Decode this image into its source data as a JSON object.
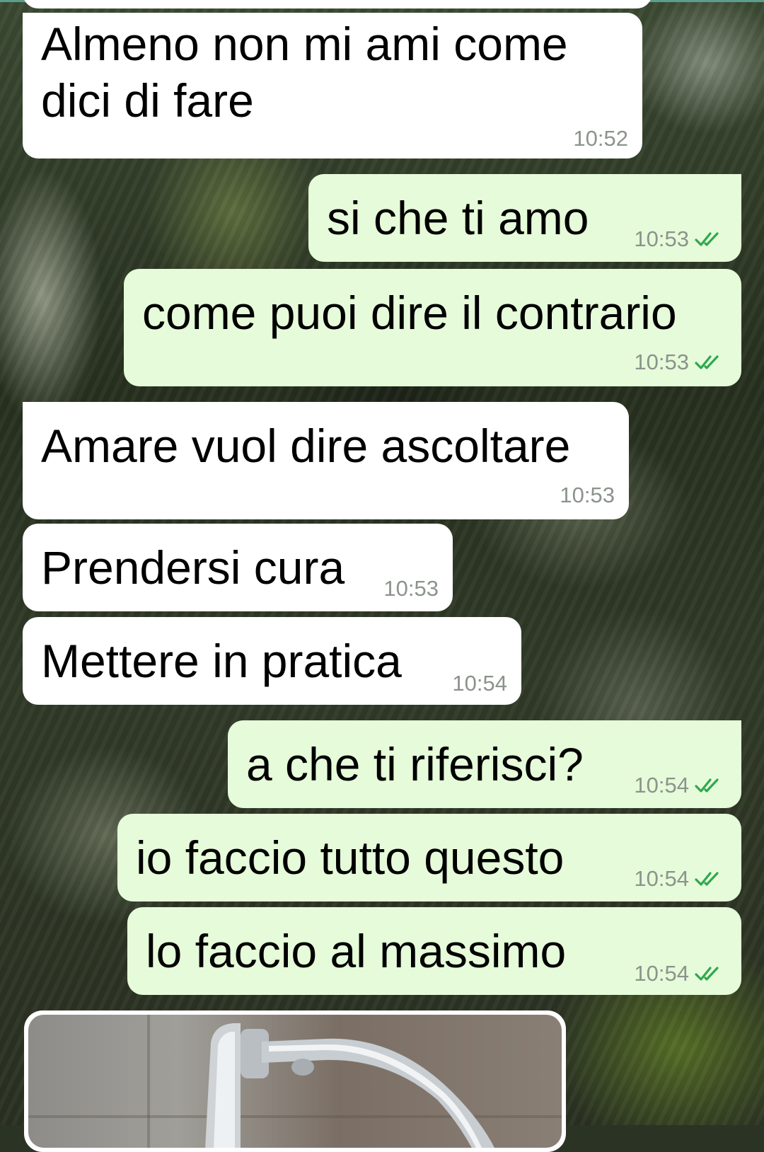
{
  "theme": {
    "incoming_bubble": "#ffffff",
    "outgoing_bubble": "#e6fbd9",
    "timestamp_color": "#8c938c",
    "read_ticks_color": "#2fa84f"
  },
  "messages": [
    {
      "direction": "in",
      "text": "Almeno non mi ami come\ndici di fare",
      "time": "10:52"
    },
    {
      "direction": "out",
      "text": "si che ti amo",
      "time": "10:53",
      "status_icon": "double-check-read-icon"
    },
    {
      "direction": "out",
      "text": "come puoi dire il contrario",
      "time": "10:53",
      "status_icon": "double-check-read-icon"
    },
    {
      "direction": "in",
      "text": "Amare vuol dire ascoltare",
      "time": "10:53"
    },
    {
      "direction": "in",
      "text": "Prendersi cura",
      "time": "10:53"
    },
    {
      "direction": "in",
      "text": "Mettere in pratica",
      "time": "10:54"
    },
    {
      "direction": "out",
      "text": "a che ti riferisci?",
      "time": "10:54",
      "status_icon": "double-check-read-icon"
    },
    {
      "direction": "out",
      "text": "io faccio tutto questo",
      "time": "10:54",
      "status_icon": "double-check-read-icon"
    },
    {
      "direction": "out",
      "text": "lo faccio al massimo",
      "time": "10:54",
      "status_icon": "double-check-read-icon"
    }
  ],
  "attachment": {
    "type": "photo",
    "subject": "faucet-photo"
  }
}
